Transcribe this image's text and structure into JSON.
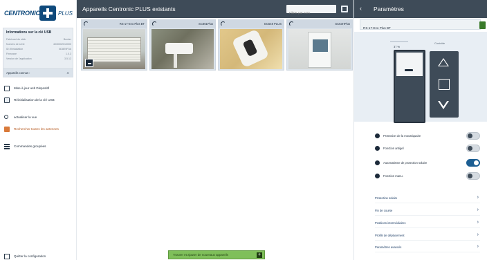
{
  "logo": {
    "brand": "CENTRONIC",
    "suffix": "PLUS"
  },
  "usb": {
    "title": "Informations sur la clé USB",
    "rows": [
      {
        "k": "Fabricant du stick",
        "v": "Becker"
      },
      {
        "k": "Numéro de série",
        "v": "4030002010000"
      },
      {
        "k": "ID d'installation",
        "v": "6D8E9F0A"
      },
      {
        "k": "Firmware",
        "v": "1.0.3"
      },
      {
        "k": "Version de l'application",
        "v": "3.5.12"
      }
    ],
    "known_label": "Appareils connus :",
    "known_count": "4"
  },
  "sidebar": {
    "items": [
      {
        "label": "Mise à jour usb Dispositif"
      },
      {
        "label": "Réinitialisation de la clé USB"
      },
      {
        "label": "actualiser la vue"
      },
      {
        "label": "Rechercher toutes les antennes"
      },
      {
        "label": "Commandes groupées"
      }
    ],
    "quit_label": "Quitter la configuration"
  },
  "main": {
    "title": "Appareils Centronic PLUS existants",
    "search_placeholder": "Filtrer par nom",
    "devices": [
      {
        "name": "RS-17-Evo Plus BT"
      },
      {
        "name": "SC861Plus"
      },
      {
        "name": "EC548 PLUS"
      },
      {
        "name": "SC63HPlus"
      }
    ],
    "find_button": "Trouver et ajouter de nouveaux appareils",
    "find_plus": "+"
  },
  "right": {
    "back": "‹",
    "title": "Paramètres",
    "device_name": "RS-17-Evo Plus BT",
    "level_pct": "37 %",
    "control_label": "Contrôle",
    "toggles": [
      {
        "label": "Protection de la moustiquaire",
        "on": false
      },
      {
        "label": "Fonction antigel",
        "on": false
      },
      {
        "label": "Automatisme de protection solaire",
        "on": true
      },
      {
        "label": "Fonction manu.",
        "on": false
      }
    ],
    "links": [
      {
        "label": "Protection solaire"
      },
      {
        "label": "Fin de course"
      },
      {
        "label": "Positions intermédiaires"
      },
      {
        "label": "Profils de déplacement"
      },
      {
        "label": "Paramètres avancés"
      }
    ]
  }
}
